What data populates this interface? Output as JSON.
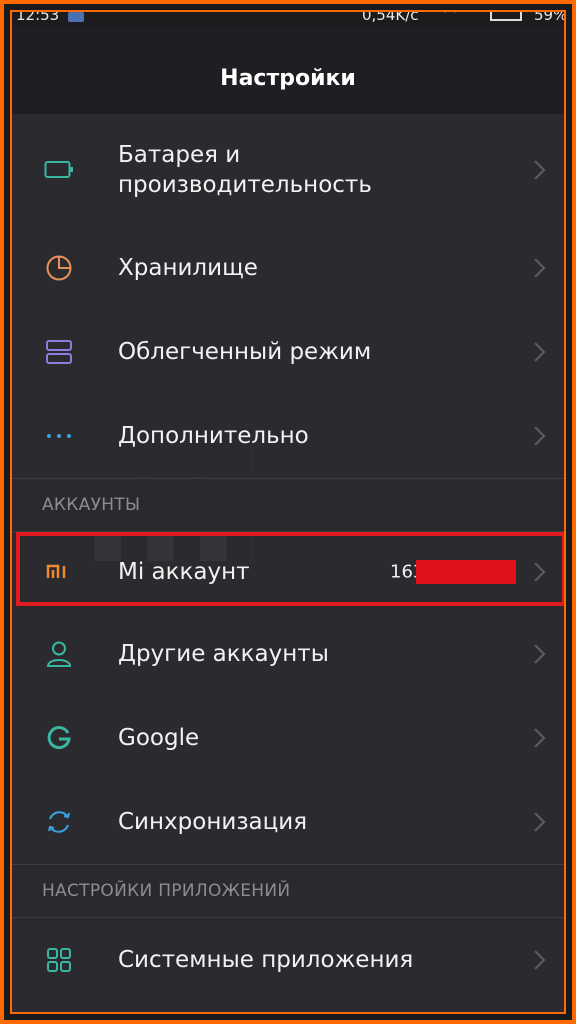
{
  "status_bar": {
    "time": "12:53",
    "speed": "0,54K/c",
    "battery": "59%"
  },
  "header": {
    "title": "Настройки"
  },
  "items_top": [
    {
      "label": "Батарея и\nпроизводительность",
      "icon": "battery-icon",
      "icon_color": "#39b7a3"
    },
    {
      "label": "Хранилище",
      "icon": "pie-chart-icon",
      "icon_color": "#e8915a"
    },
    {
      "label": "Облегченный режим",
      "icon": "stacked-rectangles-icon",
      "icon_color": "#8a7ee0"
    },
    {
      "label": "Дополнительно",
      "icon": "ellipsis-icon",
      "icon_color": "#3aa1e0"
    }
  ],
  "sections": {
    "accounts": "АККАУНТЫ",
    "app_settings": "НАСТРОЙКИ ПРИЛОЖЕНИЙ"
  },
  "accounts": {
    "mi": {
      "label": "Mi аккаунт",
      "value": "163",
      "icon": "mi-logo-icon",
      "icon_color": "#f08a2a"
    },
    "others": [
      {
        "label": "Другие аккаунты",
        "icon": "person-icon",
        "icon_color": "#39b7a3"
      },
      {
        "label": "Google",
        "icon": "google-g-icon",
        "icon_color": "#39b7a3"
      },
      {
        "label": "Синхронизация",
        "icon": "sync-icon",
        "icon_color": "#3aa1e0"
      }
    ]
  },
  "app_items": [
    {
      "label": "Системные приложения",
      "icon": "grid-icon",
      "icon_color": "#39b7a3"
    }
  ],
  "watermark": "mi",
  "colors": {
    "background": "#2b2a2f",
    "frame": "#ff6a00",
    "highlight": "#e01b22",
    "redaction": "#e0111b"
  }
}
